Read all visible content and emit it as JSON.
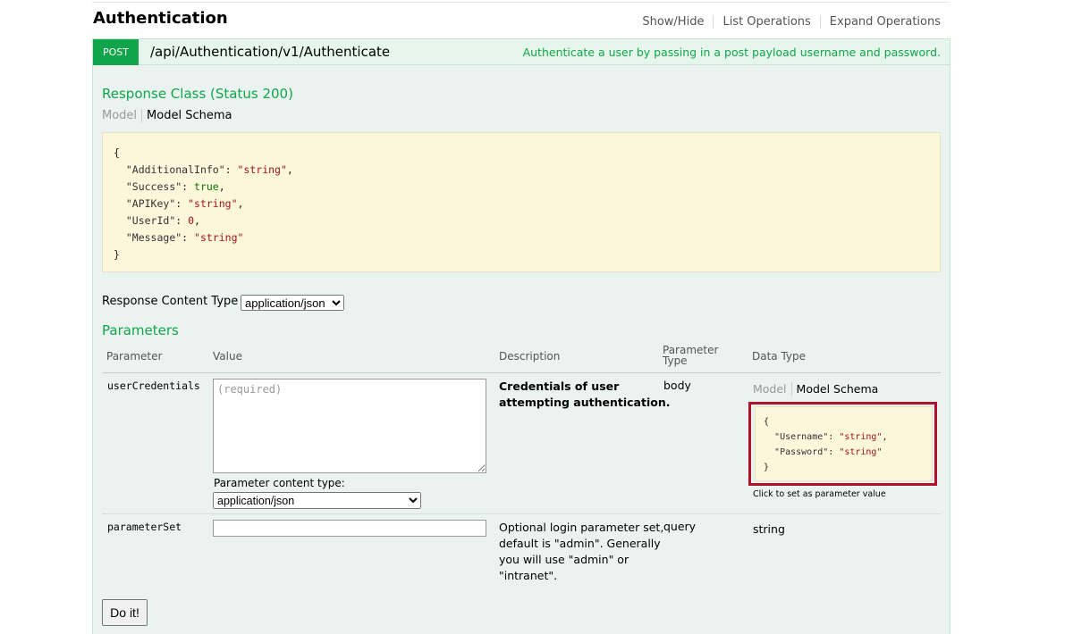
{
  "resource": {
    "title": "Authentication",
    "links": [
      "Show/Hide",
      "List Operations",
      "Expand Operations"
    ]
  },
  "operation": {
    "method": "POST",
    "path": "/api/Authentication/v1/Authenticate",
    "summary": "Authenticate a user by passing in a post payload username and password.",
    "method_color": "#10a54a"
  },
  "response_class": {
    "title": "Response Class (Status 200)",
    "tab_model": "Model",
    "tab_schema": "Model Schema",
    "open_brace": "{",
    "close_brace": "}",
    "fields": [
      {
        "key": "\"AdditionalInfo\"",
        "value": "\"string\"",
        "sep": ","
      },
      {
        "key": "\"Success\"",
        "value": "true",
        "sep": ","
      },
      {
        "key": "\"APIKey\"",
        "value": "\"string\"",
        "sep": ","
      },
      {
        "key": "\"UserId\"",
        "value": "0",
        "sep": ","
      },
      {
        "key": "\"Message\"",
        "value": "\"string\"",
        "sep": ""
      }
    ]
  },
  "response_content_type": {
    "label": "Response Content Type",
    "selected": "application/json"
  },
  "parameters": {
    "title": "Parameters",
    "headers": {
      "parameter": "Parameter",
      "value": "Value",
      "description": "Description",
      "parameter_type_line1": "Parameter",
      "parameter_type_line2": "Type",
      "data_type": "Data Type"
    },
    "rows": [
      {
        "name": "userCredentials",
        "placeholder": "(required)",
        "content_type_label": "Parameter content type:",
        "content_type_selected": "application/json",
        "description_lines": [
          "Credentials of user",
          "attempting authentication."
        ],
        "type": "body",
        "data_type": {
          "tab_model": "Model",
          "tab_schema": "Model Schema",
          "open_brace": "{",
          "close_brace": "}",
          "fields": [
            {
              "key": "\"Username\"",
              "value": "\"string\"",
              "sep": ","
            },
            {
              "key": "\"Password\"",
              "value": "\"string\"",
              "sep": ""
            }
          ],
          "hint": "Click to set as parameter value"
        }
      },
      {
        "name": "parameterSet",
        "value": "",
        "description_lines": [
          "Optional login parameter set,",
          "default is \"admin\". Generally",
          "you will use \"admin\" or",
          "\"intranet\"."
        ],
        "type": "query",
        "data_type": "string"
      }
    ]
  },
  "submit_label": "Do it!",
  "colors": {
    "accent_green": "#10a54a",
    "panel_bg": "#ebf3f0",
    "schema_bg": "#fcf6db",
    "highlight_red": "#b1142a"
  }
}
